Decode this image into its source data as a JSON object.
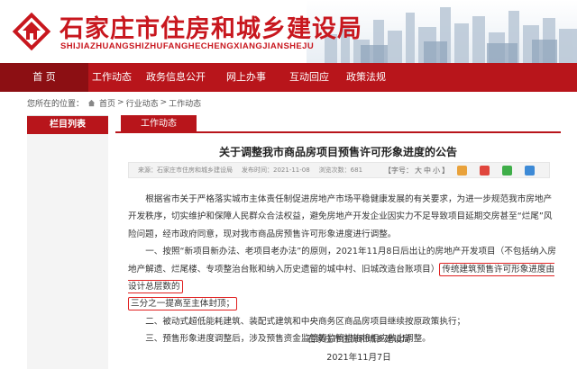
{
  "header": {
    "title": "石家庄市住房和城乡建设局",
    "pinyin": "SHIJIAZHUANGSHIZHUFANGHECHENGXIANGJIANSHEJU"
  },
  "nav": {
    "items": [
      {
        "label": "首  页",
        "active": true
      },
      {
        "label": "工作动态",
        "active": false
      },
      {
        "label": "政务信息公开",
        "active": false
      },
      {
        "label": "网上办事",
        "active": false
      },
      {
        "label": "互动回应",
        "active": false
      },
      {
        "label": "政策法规",
        "active": false
      }
    ]
  },
  "breadcrumb": {
    "prefix": "您所在的位置：",
    "home": "首页",
    "sep1": " > ",
    "level1": "行业动态",
    "sep2": " > ",
    "level2": "工作动态"
  },
  "sidebar": {
    "heading": "栏目列表"
  },
  "main": {
    "tab_label": "工作动态"
  },
  "article": {
    "title": "关于调整我市商品房项目预售许可形象进度的公告",
    "source": "来源：石家庄市住房和城乡建设局",
    "date": "发布时间：2021-11-08",
    "views": "浏览次数：681",
    "font_label": "【字号：",
    "font_big": "大",
    "font_mid": "中",
    "font_small": "小",
    "font_close": "】",
    "p1": "根据省市关于严格落实城市主体责任制促进房地产市场平稳健康发展的有关要求，为进一步规范我市房地产开发秩序，切实维护和保障人民群众合法权益，避免房地产开发企业因实力不足导致项目延期交房甚至“烂尾”风险问题，经市政府同意，现对我市商品房预售许可形象进度进行调整。",
    "p2_a": "一、按照“新项目新办法、老项目老办法”的原则，2021年11月8日后出让的房地产开发项目（不包括纳入房地产解遗、烂尾楼、专项整治台账和纳入历史遗留的城中村、旧城改造台账项目）",
    "p2_box1": "传统建筑预售许可形象进度由设计总层数的",
    "p2_box2": "三分之一提高至主体封顶；",
    "p3": "二、被动式超低能耗建筑、装配式建筑和中央商务区商品房项目继续按原政策执行；",
    "p4": "三、预售形象进度调整后，涉及预售资金监管等监管措施将相应做出调整。",
    "signer": "石家庄市住房和城乡建设局",
    "sign_date": "2021年11月7日"
  },
  "colors": {
    "brand_red": "#b8151b",
    "nav_active": "#8c0f13",
    "highlight_box": "#e02020"
  }
}
